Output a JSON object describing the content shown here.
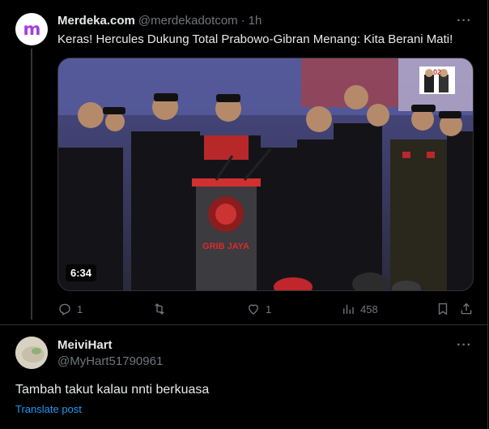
{
  "post1": {
    "avatar_text": "m",
    "display_name": "Merdeka.com",
    "handle": "@merdekadotcom",
    "separator": "·",
    "time": "1h",
    "text": "Keras! Hercules Dukung Total Prabowo-Gibran Menang: Kita Berani Mati!",
    "video_duration": "6:34",
    "video_badge": "02",
    "video_podium_text": "GRIB JAYA",
    "actions": {
      "replies": "1",
      "reposts": "",
      "likes": "1",
      "views": "458"
    }
  },
  "post2": {
    "display_name": "MeiviHart",
    "handle": "@MyHart51790961",
    "text": "Tambah takut kalau nnti berkuasa",
    "translate_label": "Translate post"
  },
  "colors": {
    "background": "#000000",
    "text_primary": "#e7e9ea",
    "text_secondary": "#71767b",
    "link": "#1d9bf0",
    "border": "#2f3336",
    "merdeka_brand": "#a43ee0"
  },
  "icons": [
    "more-icon",
    "reply-icon",
    "repost-icon",
    "like-icon",
    "views-icon",
    "bookmark-icon",
    "share-icon"
  ]
}
